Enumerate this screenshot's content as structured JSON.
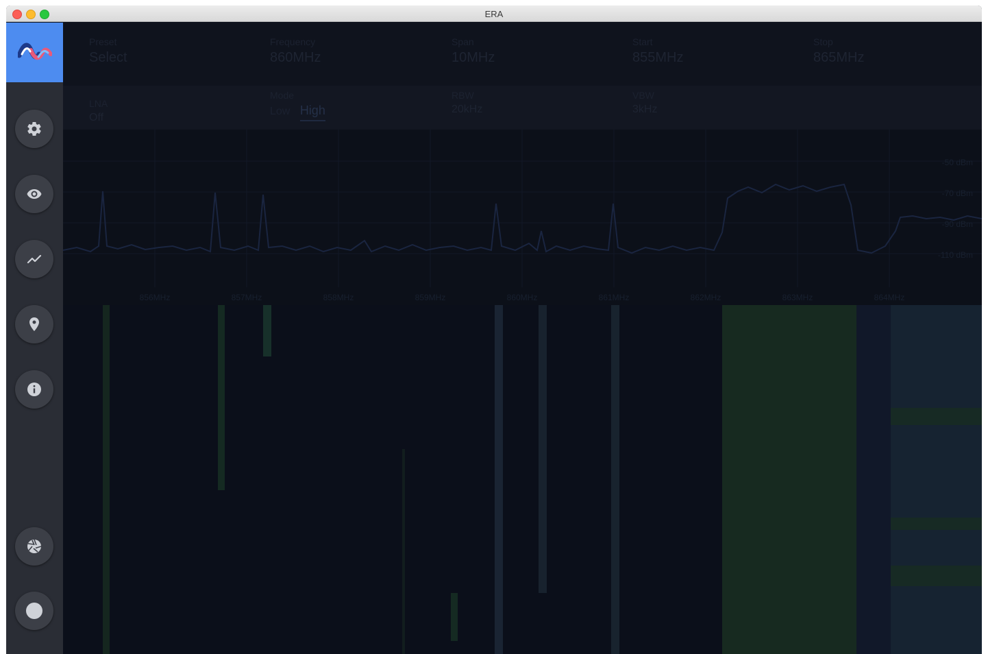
{
  "window": {
    "title": "ERA"
  },
  "controls": {
    "preset": {
      "label": "Preset",
      "value": "Select"
    },
    "frequency": {
      "label": "Frequency",
      "value": "860MHz"
    },
    "span": {
      "label": "Span",
      "value": "10MHz"
    },
    "start": {
      "label": "Start",
      "value": "855MHz"
    },
    "stop": {
      "label": "Stop",
      "value": "865MHz"
    },
    "lna": {
      "label": "LNA",
      "value": "Off"
    },
    "mode": {
      "label": "Mode",
      "low": "Low",
      "high": "High"
    },
    "rbw": {
      "label": "RBW",
      "value": "20kHz"
    },
    "vbw": {
      "label": "VBW",
      "value": "3kHz"
    }
  },
  "spectrum": {
    "y_labels": [
      "-50 dBm",
      "-70 dBm",
      "-90 dBm",
      "-110 dBm"
    ],
    "x_labels": [
      "856MHz",
      "857MHz",
      "858MHz",
      "859MHz",
      "860MHz",
      "861MHz",
      "862MHz",
      "863MHz",
      "864MHz"
    ]
  },
  "sidebar": {
    "icons": [
      "era-logo-icon",
      "settings-icon",
      "eye-icon",
      "chart-icon",
      "location-pin-icon",
      "info-icon",
      "camera-shutter-icon",
      "record-icon"
    ]
  },
  "colors": {
    "sidebar": "#2a2d35",
    "logo_bg": "#4d8cf0",
    "main_bg": "#0d111c",
    "trace": "#1a2540"
  }
}
